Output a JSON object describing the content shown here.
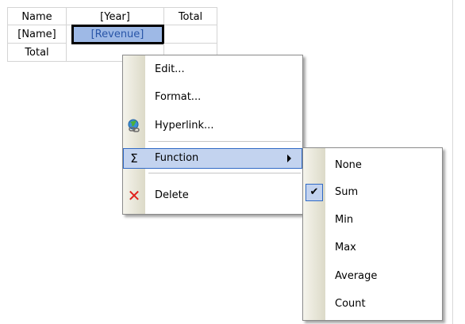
{
  "grid": {
    "header": {
      "name": "Name",
      "year": "[Year]",
      "total": "Total"
    },
    "row1": {
      "name": "[Name]",
      "revenue": "[Revenue]",
      "total": ""
    },
    "row2": {
      "name": "Total",
      "revenue": "",
      "total": ""
    }
  },
  "context_menu": {
    "items": [
      {
        "label": "Edit...",
        "icon": ""
      },
      {
        "label": "Format...",
        "icon": ""
      },
      {
        "label": "Hyperlink...",
        "icon": "globe-link-icon"
      },
      {
        "label": "Function",
        "icon": "sigma-icon",
        "glyph": "Σ",
        "has_submenu": true,
        "highlighted": true
      },
      {
        "label": "Delete",
        "icon": "delete-x-icon",
        "glyph": "✕",
        "icon_color": "#e0201b"
      }
    ]
  },
  "function_submenu": {
    "items": [
      {
        "label": "None",
        "checked": false
      },
      {
        "label": "Sum",
        "checked": true
      },
      {
        "label": "Min",
        "checked": false
      },
      {
        "label": "Max",
        "checked": false
      },
      {
        "label": "Average",
        "checked": false
      },
      {
        "label": "Count",
        "checked": false
      }
    ],
    "check_glyph": "✔"
  },
  "colors": {
    "selection_fill": "#9eb9e6",
    "menu_highlight": "#c3d3ef",
    "menu_highlight_border": "#316ac5",
    "delete_red": "#e0201b"
  }
}
